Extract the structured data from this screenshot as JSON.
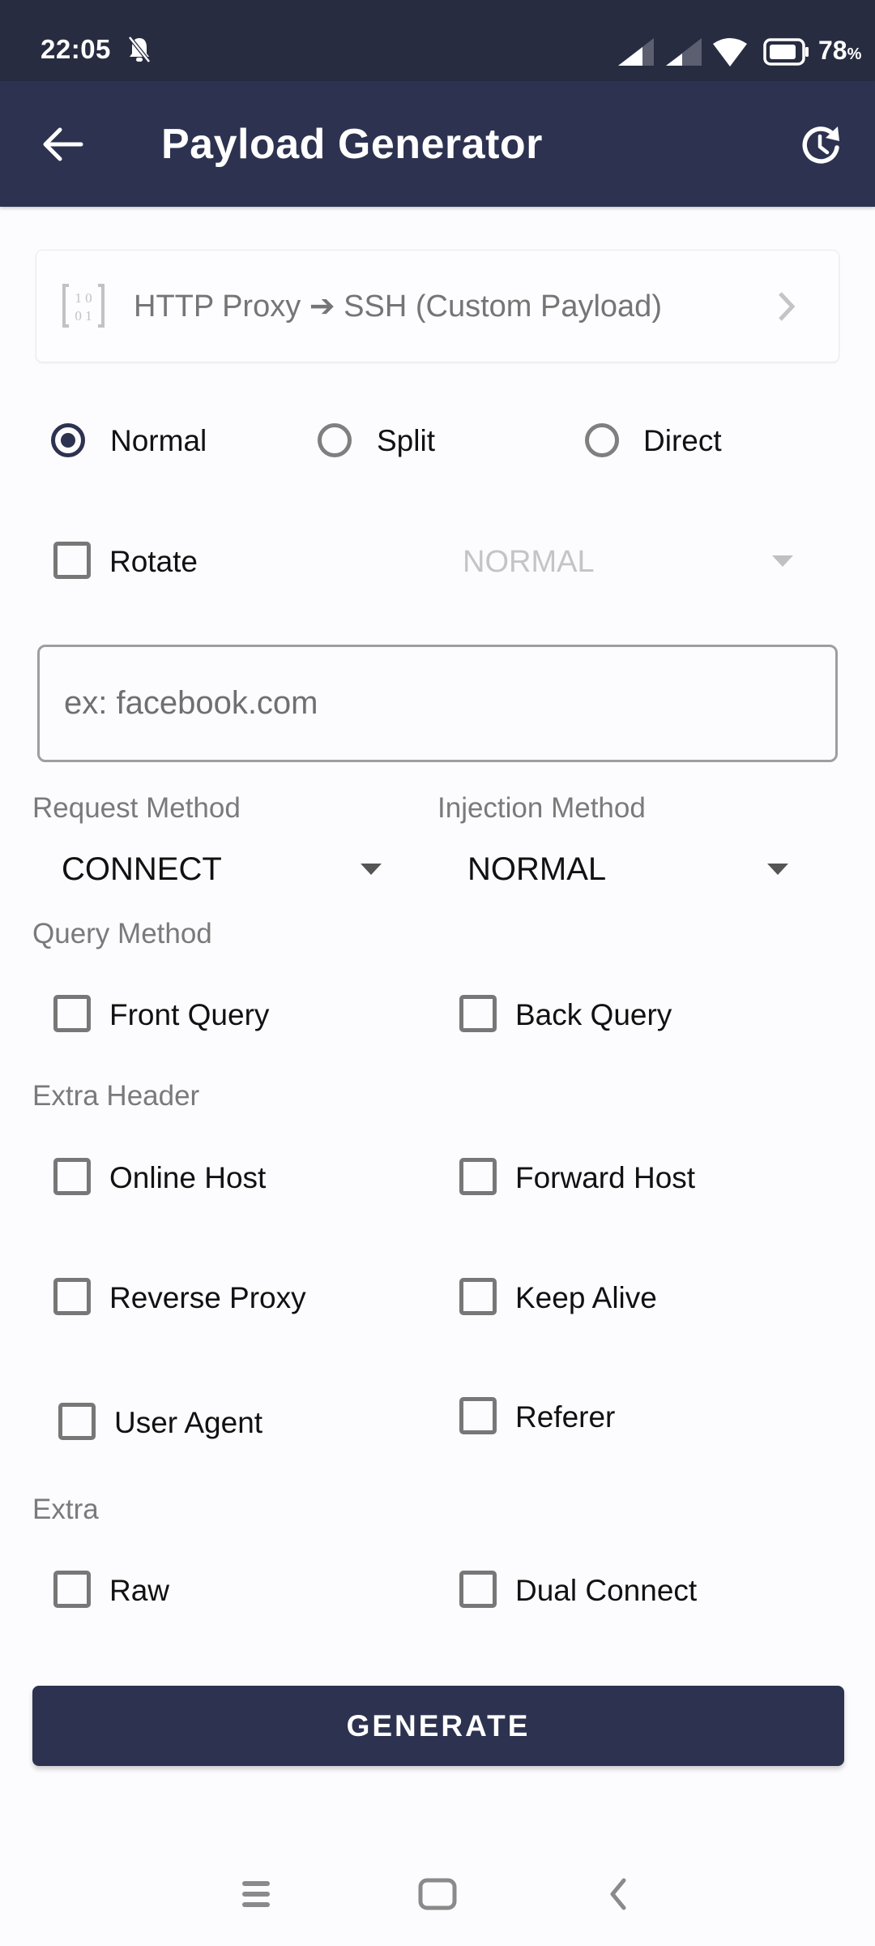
{
  "status_bar": {
    "time": "22:05",
    "battery": "78",
    "battery_unit": "%"
  },
  "app_bar": {
    "title": "Payload Generator"
  },
  "payload_type": {
    "label": "HTTP Proxy ➔ SSH (Custom Payload)"
  },
  "split_mode": {
    "options": [
      {
        "label": "Normal",
        "selected": true
      },
      {
        "label": "Split",
        "selected": false
      },
      {
        "label": "Direct",
        "selected": false
      }
    ]
  },
  "rotate": {
    "label": "Rotate",
    "checked": false,
    "dropdown_value": "NORMAL"
  },
  "host_input": {
    "value": "",
    "placeholder": "ex: facebook.com"
  },
  "request_method": {
    "label": "Request Method",
    "value": "CONNECT"
  },
  "injection_method": {
    "label": "Injection Method",
    "value": "NORMAL"
  },
  "query_method": {
    "label": "Query Method",
    "options": [
      {
        "label": "Front Query",
        "checked": false
      },
      {
        "label": "Back Query",
        "checked": false
      }
    ]
  },
  "extra_header": {
    "label": "Extra Header",
    "options": [
      {
        "label": "Online Host",
        "checked": false
      },
      {
        "label": "Forward Host",
        "checked": false
      },
      {
        "label": "Reverse Proxy",
        "checked": false
      },
      {
        "label": "Keep Alive",
        "checked": false
      },
      {
        "label": "User Agent",
        "checked": false
      },
      {
        "label": "Referer",
        "checked": false
      }
    ]
  },
  "extra": {
    "label": "Extra",
    "options": [
      {
        "label": "Raw",
        "checked": false
      },
      {
        "label": "Dual Connect",
        "checked": false
      }
    ]
  },
  "generate_button": {
    "label": "GENERATE"
  },
  "colors": {
    "primary": "#2d3250",
    "status_bar": "#272c40",
    "background": "#fcfbfd"
  }
}
